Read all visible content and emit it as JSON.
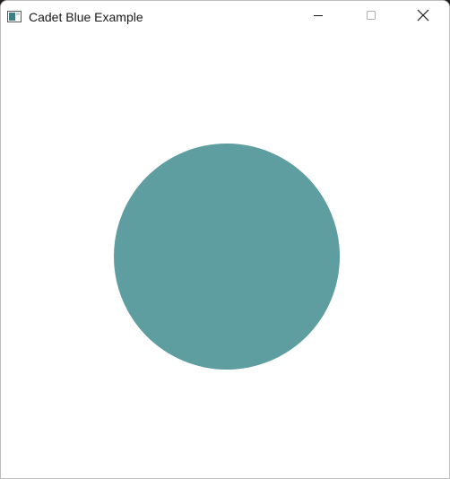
{
  "window": {
    "title": "Cadet Blue Example"
  },
  "icons": {
    "app": "app-window-icon",
    "minimize": "minimize-icon",
    "maximize": "maximize-icon",
    "close": "close-icon"
  },
  "canvas": {
    "background": "#FFFFFF",
    "circle_color": "#5F9EA0"
  }
}
